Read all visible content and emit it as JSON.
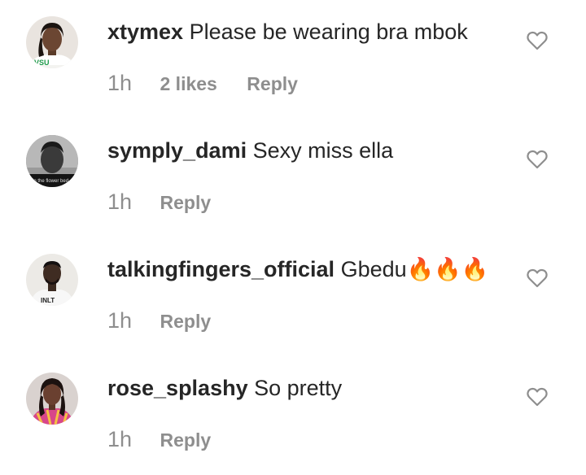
{
  "colors": {
    "text_primary": "#262626",
    "text_secondary": "#8e8e8e",
    "background": "#ffffff"
  },
  "comments": [
    {
      "username": "xtymex",
      "text": "Please be wearing bra mbok",
      "time": "1h",
      "likes": "2 likes",
      "reply_label": "Reply",
      "like_icon": "heart-outline-icon"
    },
    {
      "username": "symply_dami",
      "text": "Sexy miss ella",
      "time": "1h",
      "reply_label": "Reply",
      "like_icon": "heart-outline-icon"
    },
    {
      "username": "talkingfingers_official",
      "text": "Gbedu🔥🔥🔥",
      "time": "1h",
      "reply_label": "Reply",
      "like_icon": "heart-outline-icon"
    },
    {
      "username": "rose_splashy",
      "text": "So pretty",
      "time": "1h",
      "reply_label": "Reply",
      "like_icon": "heart-outline-icon"
    }
  ],
  "avatar_watermarks": {
    "symply_dami": "...in the flower bed",
    "talkingfingers_official": "INLT"
  }
}
